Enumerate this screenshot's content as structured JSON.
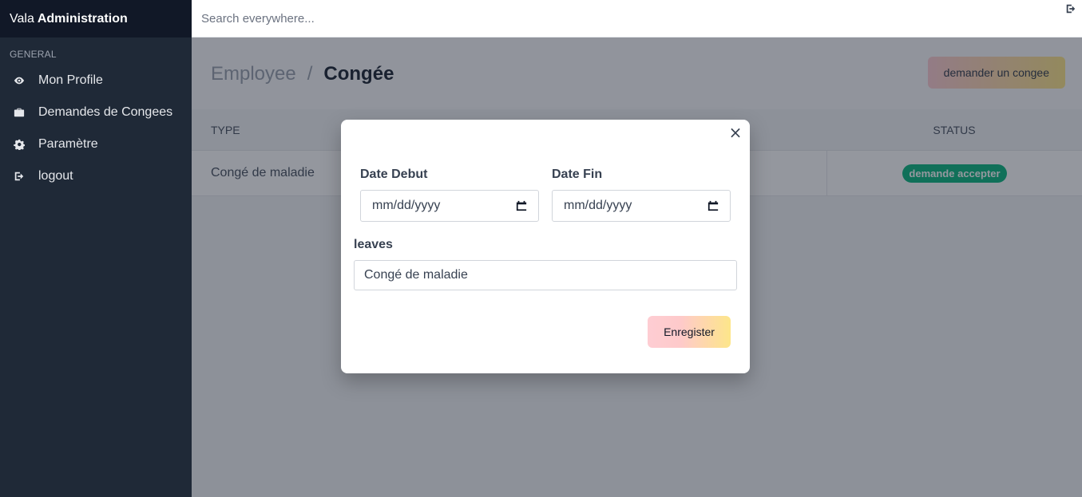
{
  "brand": {
    "prefix": "Vala",
    "bold": "Administration"
  },
  "sidebar": {
    "section_label": "GENERAL",
    "items": [
      {
        "label": "Mon Profile",
        "icon": "eye-icon"
      },
      {
        "label": "Demandes de Congees",
        "icon": "briefcase-icon"
      },
      {
        "label": "Paramètre",
        "icon": "gear-icon"
      },
      {
        "label": "logout",
        "icon": "logout-icon"
      }
    ]
  },
  "topbar": {
    "search_placeholder": "Search everywhere..."
  },
  "main": {
    "breadcrumb": {
      "parent": "Employee",
      "separator": "/",
      "current": "Congée"
    },
    "request_button": "demander un congee",
    "table": {
      "headers": {
        "type": "TYPE",
        "status": "STATUS"
      },
      "rows": [
        {
          "type": "Congé de maladie",
          "status": "demande accepter"
        }
      ]
    }
  },
  "modal": {
    "close": "×",
    "date_debut_label": "Date Debut",
    "date_debut_value": "mm/dd/yyyy",
    "date_fin_label": "Date Fin",
    "date_fin_value": "mm/dd/yyyy",
    "leaves_label": "leaves",
    "leaves_value": "Congé de maladie",
    "save_button": "Enregister"
  },
  "colors": {
    "sidebar_bg": "#1f2937",
    "brand_bg": "#111827",
    "status_badge": "#10b981",
    "button_gradient_start": "#fecdd3",
    "button_gradient_end": "#fde68a"
  }
}
